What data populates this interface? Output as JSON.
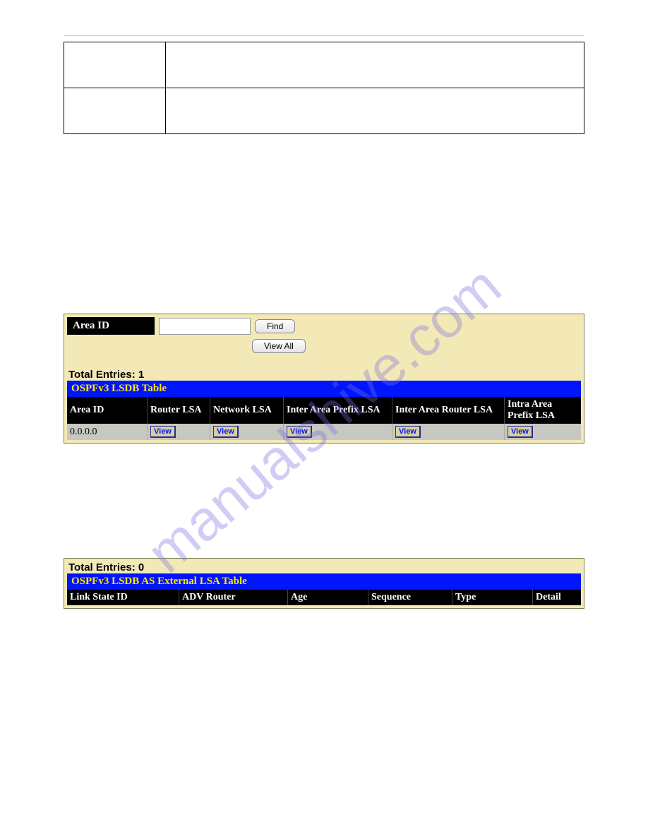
{
  "watermark": "manualshive.com",
  "search": {
    "label": "Area ID",
    "value": "",
    "find_btn": "Find",
    "viewall_btn": "View All"
  },
  "table1": {
    "entries_label": "Total Entries: 1",
    "title": "OSPFv3 LSDB Table",
    "headers": [
      "Area ID",
      "Router LSA",
      "Network LSA",
      "Inter Area Prefix LSA",
      "Inter Area Router LSA",
      "Intra Area Prefix LSA"
    ],
    "row": {
      "area_id": "0.0.0.0",
      "view_label": "View"
    }
  },
  "table2": {
    "entries_label": "Total Entries: 0",
    "title": "OSPFv3 LSDB AS External LSA Table",
    "headers": [
      "Link State ID",
      "ADV Router",
      "Age",
      "Sequence",
      "Type",
      "Detail"
    ]
  }
}
